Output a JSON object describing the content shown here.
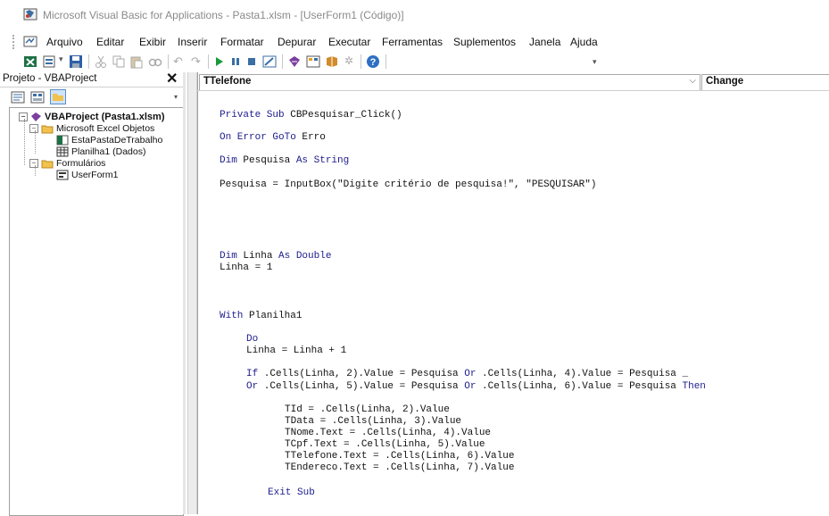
{
  "window": {
    "title": "Microsoft Visual Basic for Applications - Pasta1.xlsm - [UserForm1 (Código)]"
  },
  "menu": {
    "items": [
      "Arquivo",
      "Editar",
      "Exibir",
      "Inserir",
      "Formatar",
      "Depurar",
      "Executar",
      "Ferramentas",
      "Suplementos",
      "Janela",
      "Ajuda"
    ]
  },
  "project": {
    "title": "Projeto - VBAProject",
    "close": "✕",
    "tree": {
      "root": "VBAProject (Pasta1.xlsm)",
      "folder_excel": "Microsoft Excel Objetos",
      "sheet_workbook": "EstaPastaDeTrabalho",
      "sheet1": "Planilha1 (Dados)",
      "folder_forms": "Formulários",
      "form1": "UserForm1"
    }
  },
  "code": {
    "object_combo": "TTelefone",
    "proc_combo": "Change",
    "lines": {
      "l1_kw": "Private Sub",
      "l1_rest": " CBPesquisar_Click()",
      "l2_kw": "On Error GoTo",
      "l2_rest": " Erro",
      "l3_kw1": "Dim",
      "l3_mid": " Pesquisa ",
      "l3_kw2": "As String",
      "l4": "Pesquisa = InputBox(\"Digite critério de pesquisa!\", \"PESQUISAR\")",
      "l5_kw1": "Dim",
      "l5_mid": " Linha ",
      "l5_kw2": "As Double",
      "l6": "Linha = 1",
      "l7_kw": "With",
      "l7_rest": " Planilha1",
      "l8_kw": "Do",
      "l9": "Linha = Linha + 1",
      "l10_kw1": "If",
      "l10_a": " .Cells(Linha, 2).Value = Pesquisa ",
      "l10_kw2": "Or",
      "l10_b": " .Cells(Linha, 4).Value = Pesquisa _",
      "l11_kw1": "Or",
      "l11_a": " .Cells(Linha, 5).Value = Pesquisa ",
      "l11_kw2": "Or",
      "l11_b": " .Cells(Linha, 6).Value = Pesquisa ",
      "l11_kw3": "Then",
      "l12": "TId = .Cells(Linha, 2).Value",
      "l13": "TData = .Cells(Linha, 3).Value",
      "l14": "TNome.Text = .Cells(Linha, 4).Value",
      "l15": "TCpf.Text = .Cells(Linha, 5).Value",
      "l16": "TTelefone.Text = .Cells(Linha, 6).Value",
      "l17": "TEndereco.Text = .Cells(Linha, 7).Value",
      "l18_kw": "Exit Sub"
    }
  },
  "icons": {
    "app": "vba-app-icon",
    "colors": {
      "keyword": "#1c1c8c",
      "text": "#111111"
    }
  }
}
